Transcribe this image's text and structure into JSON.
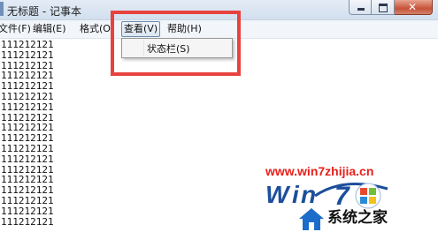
{
  "window": {
    "title": "无标题 - 记事本"
  },
  "menubar": {
    "file": "文件(F)",
    "edit": "编辑(E)",
    "format": "格式(O)",
    "view": "查看(V)",
    "help": "帮助(H)"
  },
  "view_menu": {
    "items": [
      "状态栏(S)"
    ]
  },
  "editor": {
    "lines": [
      "111212121",
      "111212121",
      "111212121",
      "111212121",
      "111212121",
      "111212121",
      "111212121",
      "111212121",
      "111212121",
      "111212121",
      "111212121",
      "111212121",
      "111212121",
      "111212121",
      "111212121",
      "111212121",
      "111212121",
      "111212121"
    ]
  },
  "watermark": {
    "url": "www.win7zhijia.cn",
    "logo_text": "系统之家"
  },
  "colors": {
    "highlight_box": "#e8423e",
    "watermark_url": "#e8201b"
  }
}
